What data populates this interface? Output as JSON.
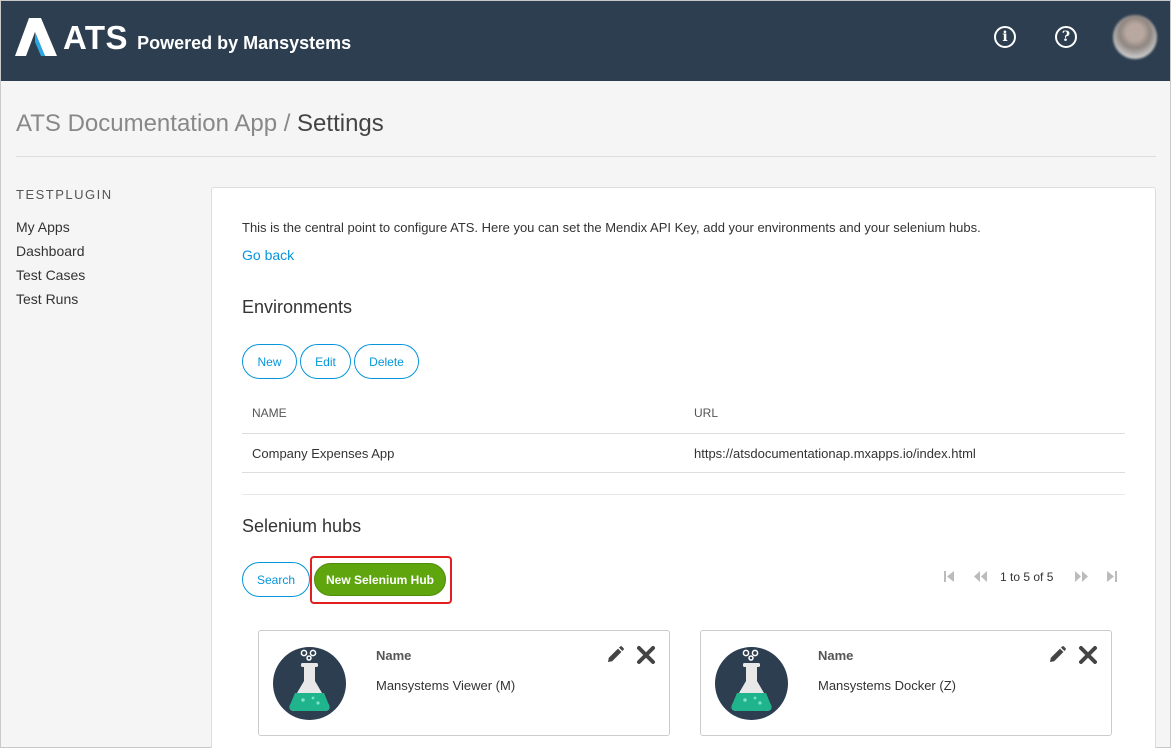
{
  "header": {
    "logo_text": "ATS",
    "powered_by": "Powered by Mansystems",
    "info_icon": "info-icon",
    "help_icon": "help-icon",
    "info_glyph": "i",
    "help_glyph": "?"
  },
  "page": {
    "title_prefix": "ATS Documentation App /",
    "title_current": "Settings"
  },
  "sidebar": {
    "heading": "TESTPLUGIN",
    "items": [
      {
        "label": "My Apps"
      },
      {
        "label": "Dashboard"
      },
      {
        "label": "Test Cases"
      },
      {
        "label": "Test Runs"
      }
    ]
  },
  "main": {
    "intro": "This is the central point to configure ATS. Here you can set the Mendix API Key, add your environments and your selenium hubs.",
    "go_back": "Go back",
    "environments": {
      "title": "Environments",
      "buttons": {
        "new": "New",
        "edit": "Edit",
        "delete": "Delete"
      },
      "columns": [
        "NAME",
        "URL"
      ],
      "rows": [
        {
          "name": "Company Expenses App",
          "url": "https://atsdocumentationap.mxapps.io/index.html"
        }
      ]
    },
    "selenium_hubs": {
      "title": "Selenium hubs",
      "search_label": "Search",
      "new_label": "New Selenium Hub",
      "pager_text": "1 to 5 of 5",
      "hubs": [
        {
          "label": "Name",
          "name": "Mansystems Viewer (M)"
        },
        {
          "label": "Name",
          "name": "Mansystems Docker (Z)"
        }
      ]
    }
  },
  "colors": {
    "header_bg": "#2c3e50",
    "accent_blue": "#0595db",
    "primary_green": "#5fa50e",
    "highlight_red": "#e02020",
    "flask_teal": "#1fb48c"
  }
}
